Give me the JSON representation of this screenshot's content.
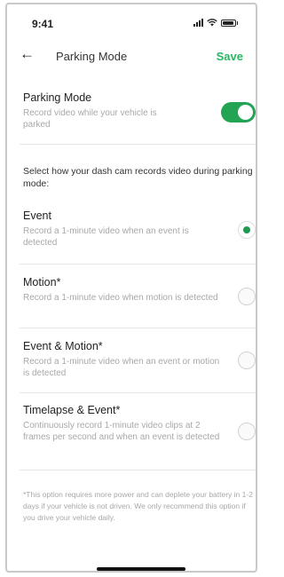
{
  "status_bar": {
    "time": "9:41"
  },
  "header": {
    "back_icon": "arrow-left-icon",
    "title": "Parking Mode",
    "save_label": "Save"
  },
  "parking_mode": {
    "title": "Parking Mode",
    "description": "Record video while your vehicle is parked",
    "enabled": true,
    "accent_color": "#23a455"
  },
  "instruction": "Select how your dash cam records video during parking mode:",
  "options": [
    {
      "title": "Event",
      "description": "Record a 1-minute video when an event is detected",
      "selected": true
    },
    {
      "title": "Motion*",
      "description": "Record a 1-minute video when motion is detected",
      "selected": false
    },
    {
      "title": "Event & Motion*",
      "description": "Record a 1-minute video when an event or motion is detected",
      "selected": false
    },
    {
      "title": "Timelapse & Event*",
      "description": "Continuously record 1-minute video clips at 2 frames per second and when an event is detected",
      "selected": false
    }
  ],
  "footnote": "*This option requires more power and can deplete your battery in 1-2 days if your vehicle is not driven. We only recommend this option if you drive your vehicle daily."
}
